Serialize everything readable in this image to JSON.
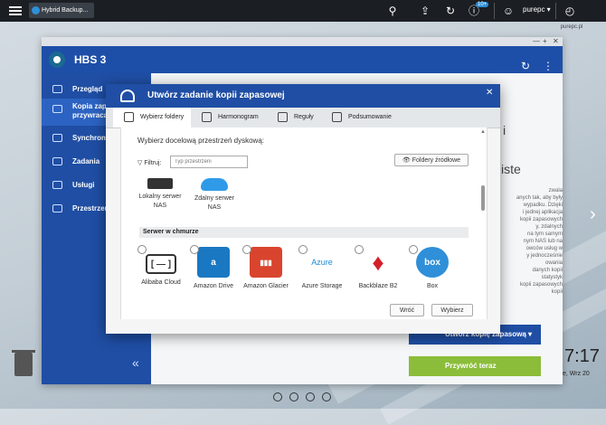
{
  "taskbar": {
    "tab_label": "Hybrid Backup...",
    "user": "purepc ▾",
    "notification_count": "10+"
  },
  "watermark": "purepc.pl",
  "hbs": {
    "title": "HBS 3",
    "sidebar": [
      {
        "label": "Przegląd"
      },
      {
        "label": "Kopia zapa..."
      },
      {
        "label": "przywraca..."
      },
      {
        "label": "Synchroni..."
      },
      {
        "label": "Zadania"
      },
      {
        "label": "Usługi"
      },
      {
        "label": "Przestrzeń..."
      }
    ],
    "right_text_big_1": "i",
    "right_text_big_2": "iste",
    "right_text_lines": [
      "zwala",
      "anych tak, aby były",
      "wypadku. Dzięki",
      "i jednej aplikacja",
      "kopii zapasowych",
      "y, zdalnych",
      "na tym samym",
      "nym NAS lub na",
      "owców usług w",
      "y jednocześnie",
      "owania",
      "danych kopii",
      "statystyk",
      "kopii zapasowych",
      "kopii"
    ],
    "backup_button": "Utwórz kopię zapasową",
    "restore_button": "Przywróć teraz",
    "clock": "7:17",
    "date": "e, Wrz 20"
  },
  "modal": {
    "title": "Utwórz zadanie kopii zapasowej",
    "steps": [
      "Wybierz foldery",
      "Harmonogram",
      "Reguły",
      "Podsumowanie"
    ],
    "prompt": "Wybierz docelową przestrzeń dyskową:",
    "filter_label": "Filtruj:",
    "filter_placeholder": "Typ przestrzeni",
    "source_folders_button": "Foldery źródłowe",
    "local_nas": "Lokalny serwer NAS",
    "remote_nas": "Zdalny serwer NAS",
    "cloud_section": "Serwer w chmurze",
    "cloud_services": [
      {
        "name": "Alibaba Cloud",
        "logo_text": "[ — ]",
        "color": "#ffffff"
      },
      {
        "name": "Amazon Drive",
        "logo_text": "a",
        "color": "#1a78c2"
      },
      {
        "name": "Amazon Glacier",
        "logo_text": "▮▮▮",
        "color": "#d9442e"
      },
      {
        "name": "Azure Storage",
        "logo_text": "Azure",
        "color": "#ffffff"
      },
      {
        "name": "Backblaze B2",
        "logo_text": "♦",
        "color": "#ffffff"
      },
      {
        "name": "Box",
        "logo_text": "box",
        "color": "#2f8fd8"
      }
    ],
    "back_button": "Wróć",
    "select_button": "Wybierz"
  }
}
